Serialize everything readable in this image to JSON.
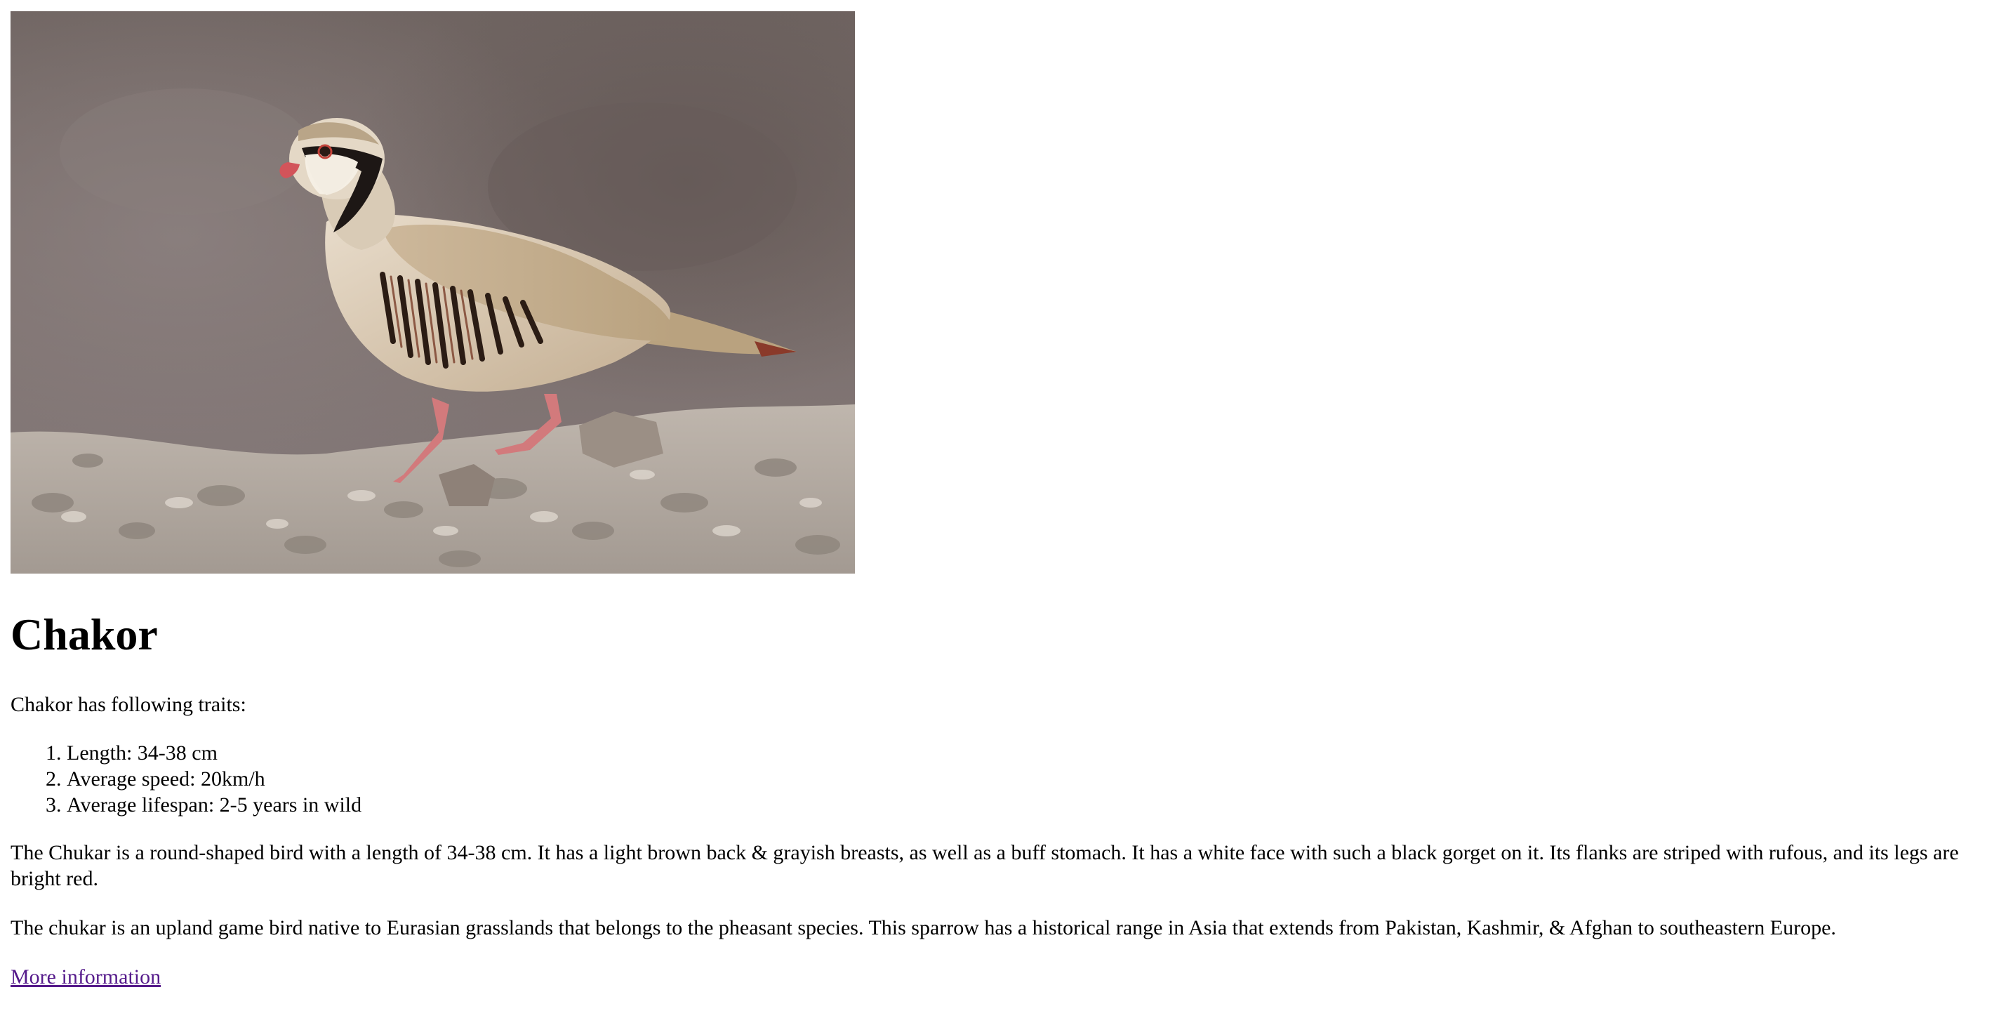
{
  "image": {
    "icon": "chukar-partridge-photo"
  },
  "title": "Chakor",
  "intro": "Chakor has following traits:",
  "traits": [
    "Length: 34-38 cm",
    "Average speed: 20km/h",
    "Average lifespan: 2-5 years in wild"
  ],
  "paragraphs": [
    "The Chukar is a round-shaped bird with a length of 34-38 cm. It has a light brown back & grayish breasts, as well as a buff stomach. It has a white face with such a black gorget on it. Its flanks are striped with rufous, and its legs are bright red.",
    "The chukar is an upland game bird native to Eurasian grasslands that belongs to the pheasant species. This sparrow has a historical range in Asia that extends from Pakistan, Kashmir, & Afghan to southeastern Europe."
  ],
  "link": {
    "label": "More information"
  },
  "colors": {
    "link": "#551a8b",
    "text": "#000000",
    "background": "#ffffff"
  }
}
